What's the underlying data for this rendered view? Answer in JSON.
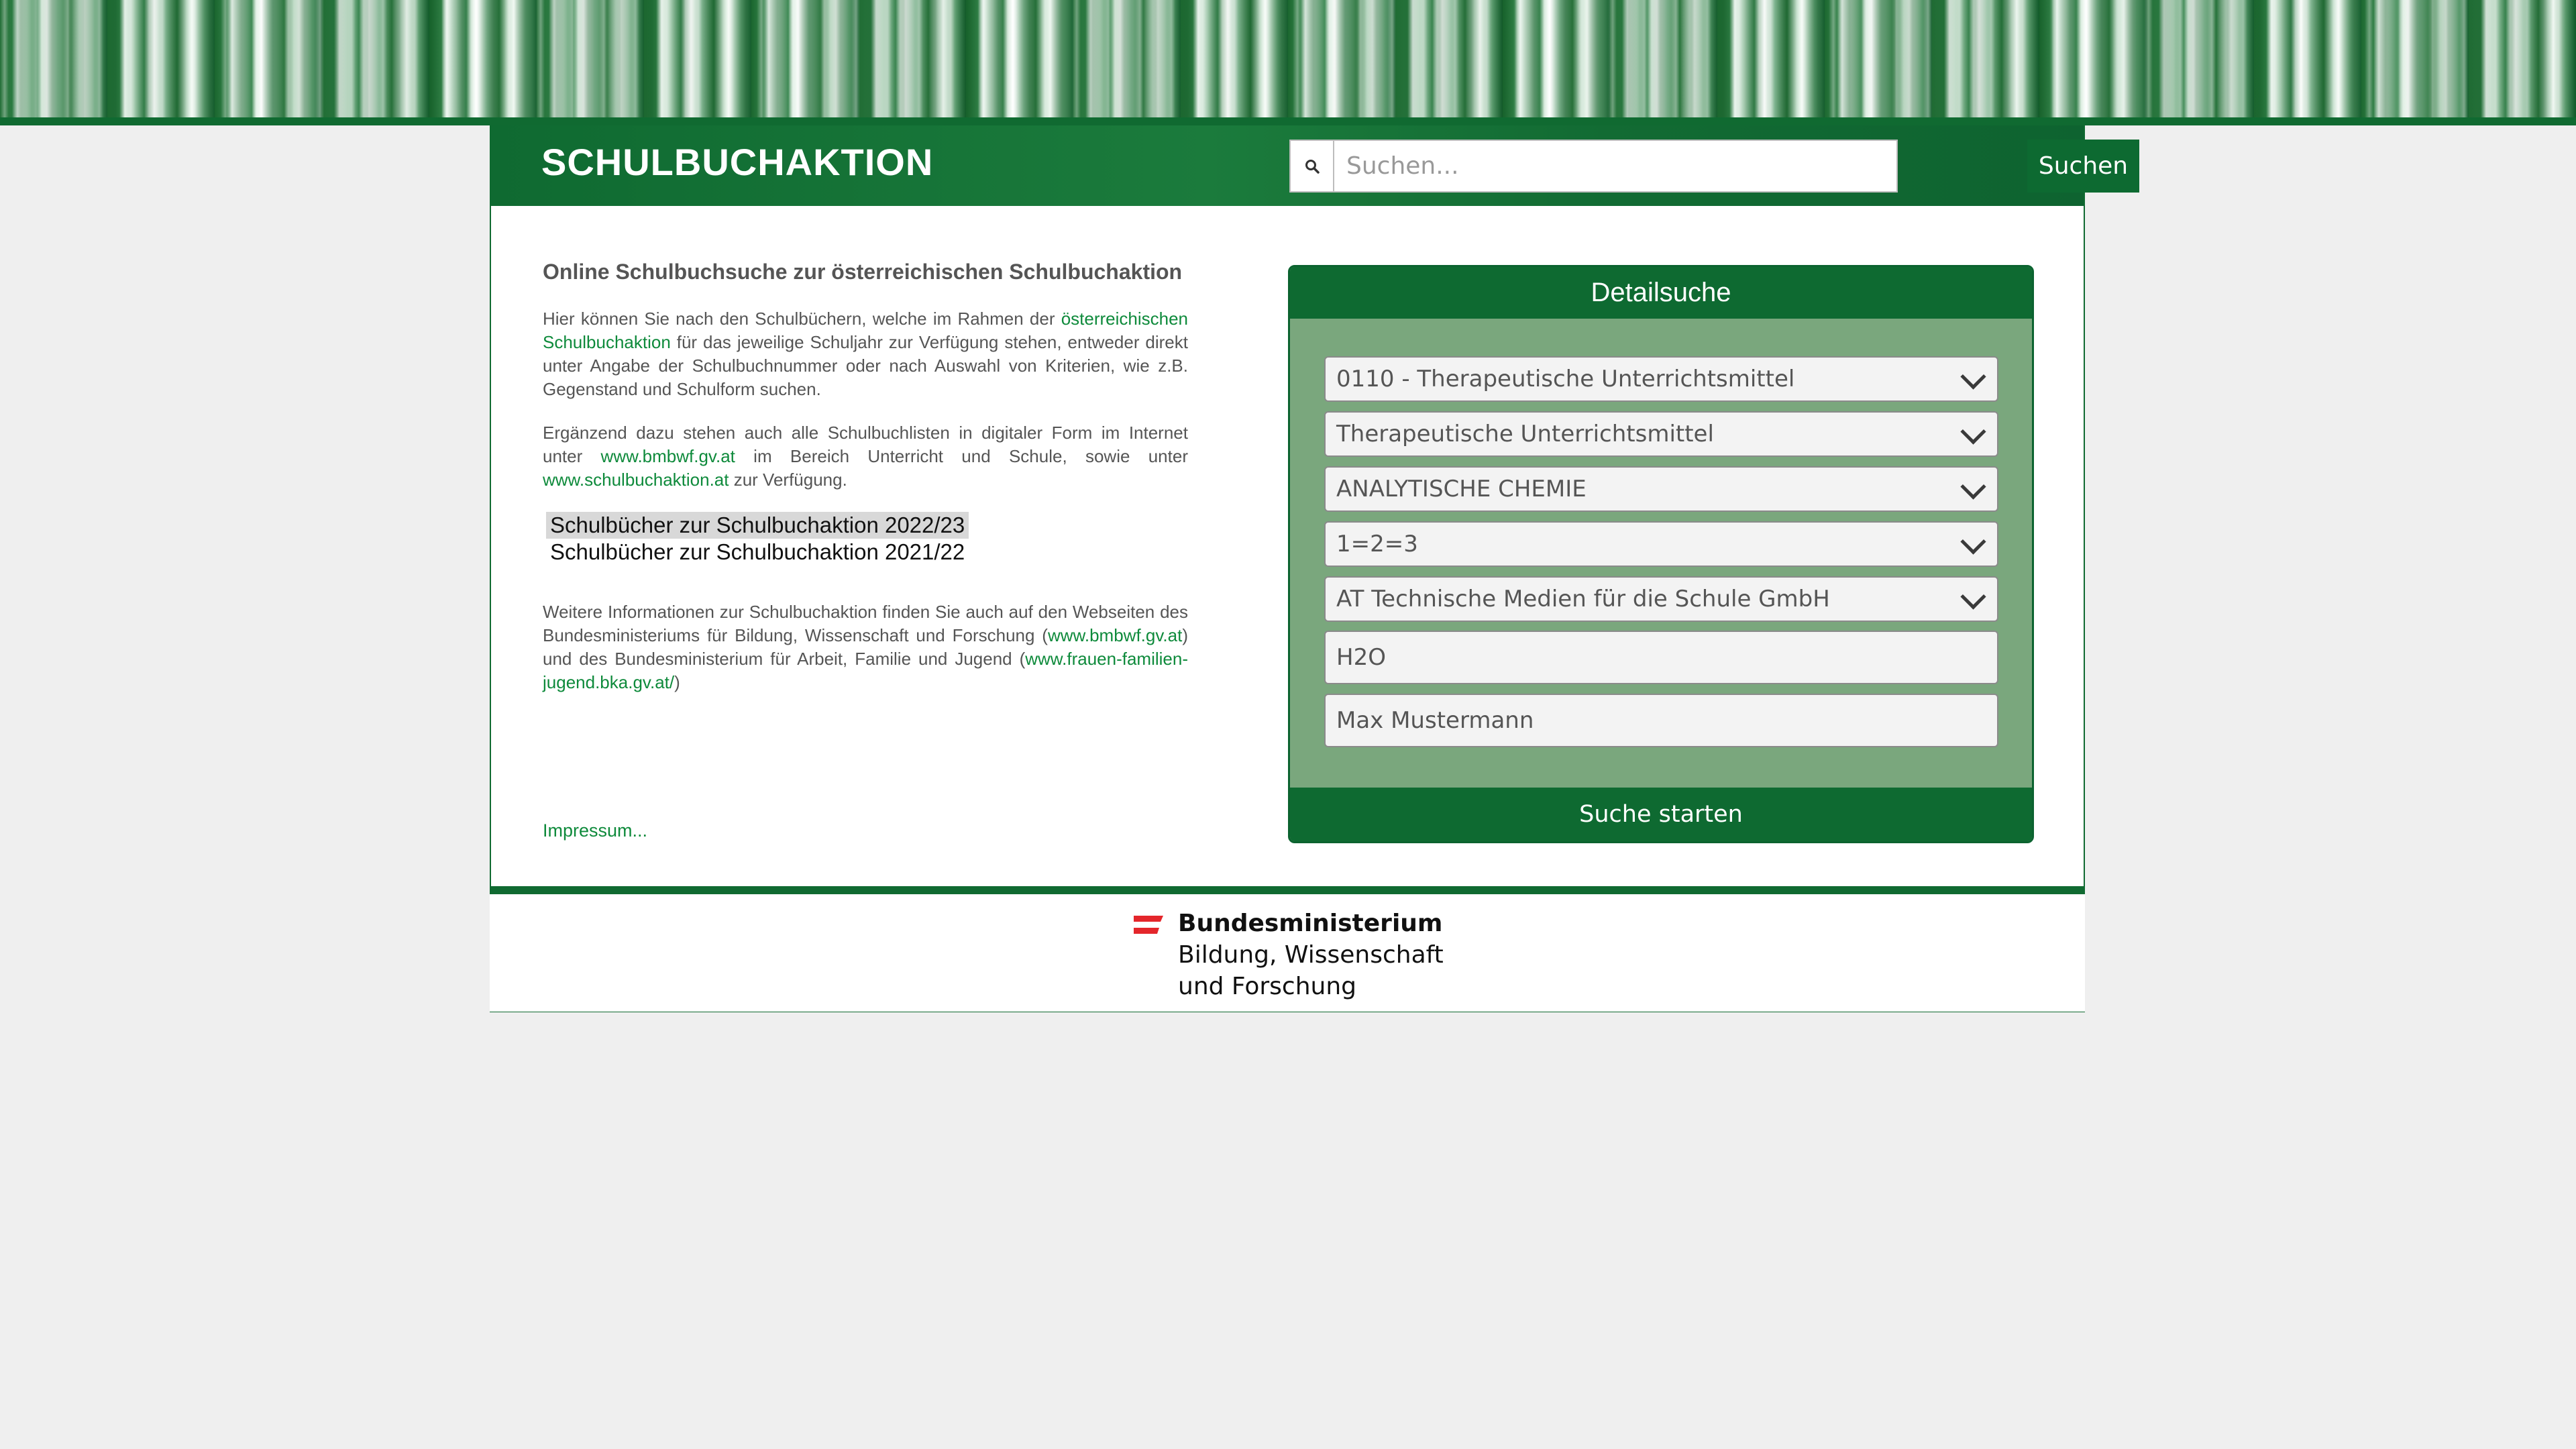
{
  "header": {
    "site_title": "SCHULBUCHAKTION",
    "search_placeholder": "Suchen...",
    "search_button": "Suchen"
  },
  "intro": {
    "title": "Online Schulbuchsuche zur österreichischen Schulbuchaktion",
    "p1_a": "Hier können Sie nach den Schulbüchern, welche im Rahmen der ",
    "p1_link": "österreichischen Schulbuchaktion",
    "p1_b": " für das jeweilige Schuljahr zur Verfügung stehen, entweder direkt unter Angabe der Schulbuchnummer oder nach Auswahl von Kriterien, wie z.B. Gegenstand und Schulform suchen.",
    "p2_a": "Ergänzend dazu stehen auch alle Schulbuchlisten in digitaler Form im Internet unter ",
    "p2_link1": "www.bmbwf.gv.at",
    "p2_b": " im Bereich Unterricht und Schule, sowie unter ",
    "p2_link2": "www.schulbuchaktion.at",
    "p2_c": " zur Verfügung.",
    "list_links": [
      "Schulbücher zur Schulbuchaktion 2022/23",
      "Schulbücher zur Schulbuchaktion 2021/22"
    ],
    "p3_a": "Weitere Informationen zur Schulbuchaktion finden Sie auch auf den Webseiten des Bundesministeriums für Bildung, Wissenschaft und Forschung (",
    "p3_link1": "www.bmbwf.gv.at",
    "p3_b": ") und des Bundesministerium für Arbeit, Familie und Jugend (",
    "p3_link2": "www.frauen-familien-jugend.bka.gv.at/",
    "p3_c": ")",
    "impressum": "Impressum..."
  },
  "detail": {
    "title": "Detailsuche",
    "selects": [
      "0110 - Therapeutische Unterrichtsmittel",
      "Therapeutische Unterrichtsmittel",
      "ANALYTISCHE CHEMIE",
      "1=2=3",
      "AT Technische Medien für die Schule GmbH"
    ],
    "field_title": "H2O",
    "field_author": "Max Mustermann",
    "submit": "Suche starten"
  },
  "footer": {
    "line1": "Bundesministerium",
    "line2": "Bildung, Wissenschaft",
    "line3": "und Forschung"
  },
  "colors": {
    "brand_green": "#106a31",
    "panel_green": "#7aa77d",
    "link_green": "#0e8a3b",
    "flag_red": "#e4262b"
  }
}
